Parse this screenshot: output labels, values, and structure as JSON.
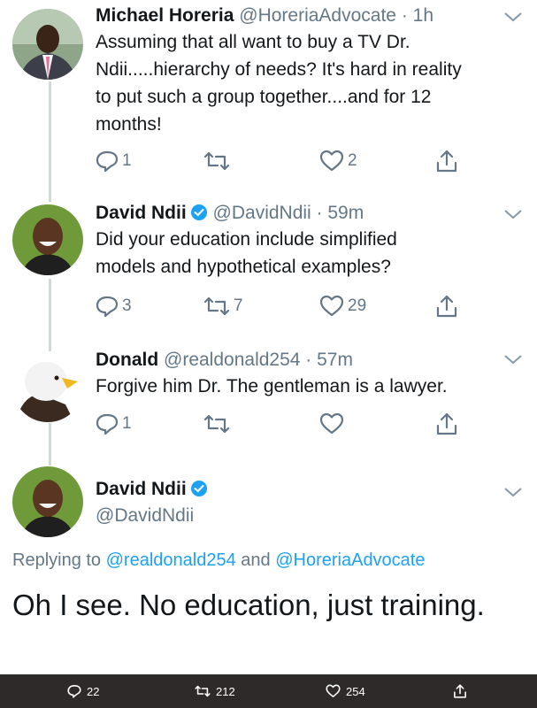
{
  "colors": {
    "accent": "#1da1f2",
    "muted": "#657786",
    "text": "#14171a",
    "verified": "#1da1f2",
    "bar": "#2f2a2a"
  },
  "tweets": [
    {
      "name": "Michael Horeria",
      "handle_time": "@HoreriaAdvocate · 1h",
      "lines": [
        "Assuming that all want to buy  a TV Dr.",
        "Ndii.....hierarchy of needs? It's hard in reality",
        "to put such  a group together....and for 12",
        "months!"
      ],
      "replies": "1",
      "retweets": "",
      "likes": "2"
    },
    {
      "name": "David Ndii",
      "handle_time": "@DavidNdii · 59m",
      "lines": [
        "Did your education include simplified",
        "models and hypothetical examples?"
      ],
      "replies": "3",
      "retweets": "7",
      "likes": "29"
    },
    {
      "name": "Donald",
      "handle_time": "@realdonald254 · 57m",
      "lines": [
        "Forgive him Dr. The gentleman is a lawyer."
      ],
      "replies": "1",
      "retweets": "",
      "likes": ""
    }
  ],
  "main_tweet": {
    "name": "David Ndii",
    "handle": "@DavidNdii",
    "replying_prefix": "Replying to",
    "replying_to_1": "@realdonald254",
    "replying_and": "and",
    "replying_to_2": "@HoreriaAdvocate",
    "text": "Oh I see. No education, just training."
  },
  "bottom_bar": {
    "replies": "22",
    "retweets": "212",
    "likes": "254"
  },
  "icons": [
    "reply-icon",
    "retweet-icon",
    "heart-icon",
    "share-icon",
    "chevron-down-icon",
    "verified-badge-icon"
  ]
}
